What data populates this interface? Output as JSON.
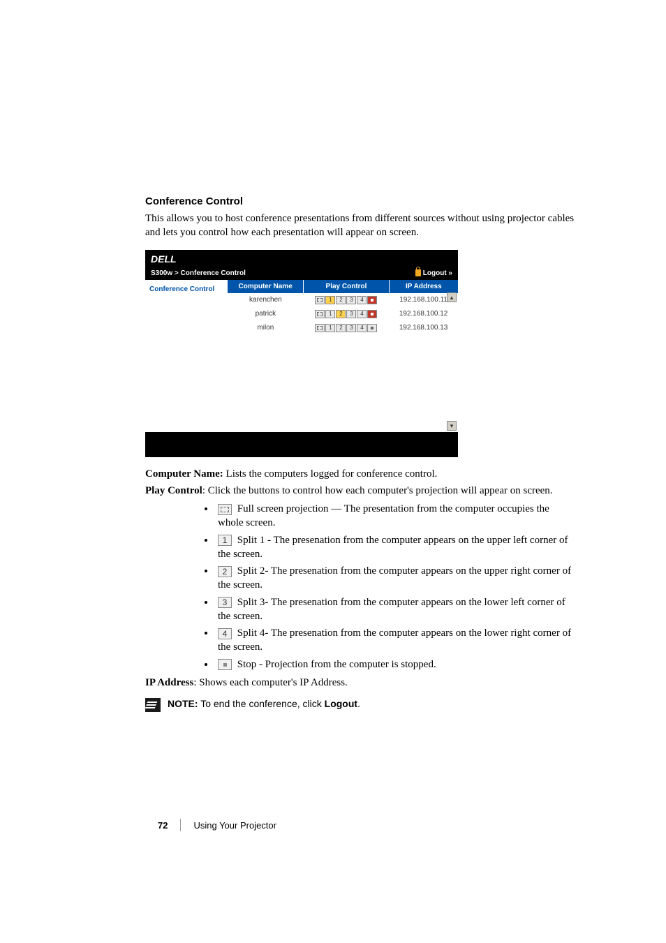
{
  "section": {
    "title": "Conference Control",
    "intro": "This allows you to host conference presentations from different sources without using projector cables and lets you control how each presentation will appear on screen."
  },
  "app": {
    "logo_text": "DELL",
    "breadcrumb": {
      "model": "S300w",
      "sep": ">",
      "page": "Conference Control",
      "logout": "Logout »"
    },
    "sidebar": {
      "item": "Conference Control"
    },
    "table": {
      "headers": {
        "name": "Computer Name",
        "play": "Play Control",
        "ip": "IP Address"
      },
      "rows": [
        {
          "name": "karenchen",
          "ip": "192.168.100.11",
          "active": "1",
          "stop_active": true
        },
        {
          "name": "patrick",
          "ip": "192.168.100.12",
          "active": "2",
          "stop_active": true
        },
        {
          "name": "milon",
          "ip": "192.168.100.13",
          "active": "",
          "stop_active": false
        }
      ],
      "btn_labels": {
        "b1": "1",
        "b2": "2",
        "b3": "3",
        "b4": "4"
      }
    }
  },
  "desc": {
    "computer_name_label": "Computer Name:",
    "computer_name_text": " Lists the computers logged for conference control.",
    "play_control_label": "Play Control",
    "play_control_text": ": Click the buttons to control how each computer's projection will appear on screen.",
    "items": {
      "fs": " Full screen projection — The presentation from the computer occupies the whole screen.",
      "s1_num": "1",
      "s1": " Split 1 - The presenation from the computer appears on the upper left corner of the screen.",
      "s2_num": "2",
      "s2": " Split 2- The presenation from the computer appears on the upper right corner of the screen.",
      "s3_num": "3",
      "s3": " Split 3- The presenation from the computer appears on the lower left corner of the screen.",
      "s4_num": "4",
      "s4": " Split 4- The presenation from the computer appears on the lower right corner of the screen.",
      "stop": " Stop - Projection from the computer is stopped."
    },
    "ip_label": "IP Address",
    "ip_text": ": Shows each computer's IP Address."
  },
  "note": {
    "label": "NOTE:",
    "text_before": " To end the conference, click ",
    "logout_word": "Logout",
    "text_after": "."
  },
  "footer": {
    "page": "72",
    "chapter": "Using Your Projector"
  }
}
